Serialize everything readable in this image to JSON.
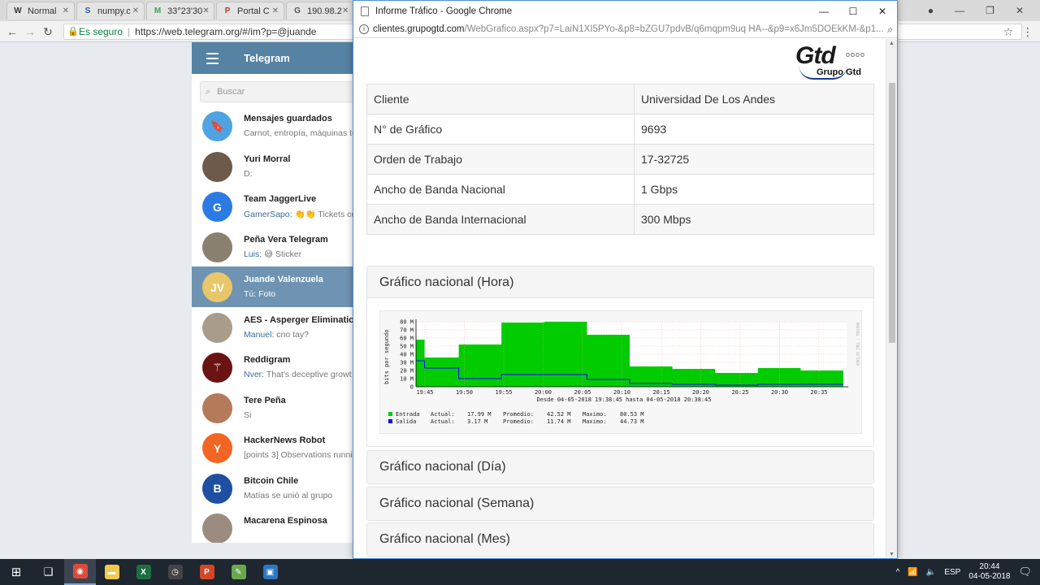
{
  "bg_browser": {
    "tabs": [
      {
        "label": "Normal",
        "icon": "wikipedia-icon",
        "glyph": "W",
        "color": "#333333"
      },
      {
        "label": "numpy.c",
        "icon": "numpy-icon",
        "glyph": "S",
        "color": "#2a5db0"
      },
      {
        "label": "33°23'30",
        "icon": "maps-icon",
        "glyph": "M",
        "color": "#34a853"
      },
      {
        "label": "Portal C",
        "icon": "portal-icon",
        "glyph": "P",
        "color": "#c0392b"
      },
      {
        "label": "190.98.2",
        "icon": "chart-tab-icon",
        "glyph": "G",
        "color": "#555555"
      }
    ],
    "secure_label": "Es seguro",
    "url": "https://web.telegram.org/#/im?p=@juande"
  },
  "telegram": {
    "title": "Telegram",
    "search_placeholder": "Buscar",
    "chats": [
      {
        "name": "Mensajes guardados",
        "who": "",
        "msg": "Carnot, entropía, máquinas té",
        "avatar_color": "#4fa3e0",
        "avatar_text": "🔖",
        "active": false
      },
      {
        "name": "Yuri Morral",
        "who": "",
        "msg": "D:",
        "avatar_color": "#6d5a4b",
        "avatar_text": "",
        "active": false
      },
      {
        "name": "Team JaggerLive",
        "who": "GamerSapo:",
        "msg": "👏👏 Tickets co",
        "avatar_color": "#2c7be5",
        "avatar_text": "G",
        "active": false
      },
      {
        "name": "Peña Vera Telegram",
        "who": "Luis:",
        "msg": "😅 Sticker",
        "avatar_color": "#8a8070",
        "avatar_text": "",
        "active": false
      },
      {
        "name": "Juande Valenzuela",
        "who": "",
        "msg": "Tú: Foto",
        "avatar_color": "#e8c76a",
        "avatar_text": "JV",
        "active": true
      },
      {
        "name": "AES - Asperger Eliminatio",
        "who": "Manuel:",
        "msg": "cno tay?",
        "avatar_color": "#a99c8a",
        "avatar_text": "",
        "active": false
      },
      {
        "name": "Reddigram",
        "who": "Nver:",
        "msg": "That's deceptive growt",
        "avatar_color": "#6b1212",
        "avatar_text": "⚚",
        "active": false
      },
      {
        "name": "Tere Peña",
        "who": "",
        "msg": "Si",
        "avatar_color": "#b57a5a",
        "avatar_text": "",
        "active": false
      },
      {
        "name": "HackerNews Robot",
        "who": "",
        "msg": "[points 3] Observations runni",
        "avatar_color": "#f26522",
        "avatar_text": "Y",
        "active": false
      },
      {
        "name": "Bitcoin Chile",
        "who": "",
        "msg": "Matías se unió al grupo",
        "avatar_color": "#1e4fa0",
        "avatar_text": "B",
        "active": false
      },
      {
        "name": "Macarena Espinosa",
        "who": "",
        "msg": "",
        "avatar_color": "#9c8c80",
        "avatar_text": "",
        "active": false
      }
    ]
  },
  "popup": {
    "window_title": "Informe Tráfico - Google Chrome",
    "url_host": "clientes.grupogtd.com",
    "url_path": "/WebGrafico.aspx?p7=LaiN1XI5PYo-&p8=bZGU7pdvB/q6mqpm9uq HA--&p9=x6Jm5DOEkKM-&p1...",
    "logo_text": "Gtd",
    "logo_dots": "oooo",
    "logo_sub": "Grupo Gtd",
    "info_rows": [
      {
        "k": "Cliente",
        "v": "Universidad De Los Andes"
      },
      {
        "k": "N° de Gráfico",
        "v": "9693"
      },
      {
        "k": "Orden de Trabajo",
        "v": "17-32725"
      },
      {
        "k": "Ancho de Banda Nacional",
        "v": "1 Gbps"
      },
      {
        "k": "Ancho de Banda Internacional",
        "v": "300 Mbps"
      }
    ],
    "panels": [
      {
        "title": "Gráfico nacional (Hora)"
      },
      {
        "title": "Gráfico nacional (Día)"
      },
      {
        "title": "Gráfico nacional (Semana)"
      },
      {
        "title": "Gráfico nacional (Mes)"
      }
    ]
  },
  "chart_data": {
    "type": "area",
    "ylabel": "bits por segundo",
    "right_label": "RRDTOOL / TOBI OETIKER",
    "ylim": [
      0,
      80
    ],
    "y_ticks": [
      "0",
      "10 M",
      "20 M",
      "30 M",
      "40 M",
      "50 M",
      "60 M",
      "70 M",
      "80 M"
    ],
    "x_tick_labels": [
      "19:45",
      "19:50",
      "19:55",
      "20:00",
      "20:05",
      "20:10",
      "20:15",
      "20:20",
      "20:25",
      "20:30",
      "20:35"
    ],
    "time_range": "Desde 04-05-2018 19:38:45 hasta 04-05-2018 20:38:45",
    "series": [
      {
        "name": "Entrada",
        "color": "#00cc00",
        "values": [
          58,
          36,
          36,
          36,
          36,
          52,
          52,
          52,
          52,
          52,
          79,
          79,
          79,
          79,
          79,
          80,
          80,
          80,
          80,
          80,
          64,
          64,
          64,
          64,
          64,
          25,
          25,
          25,
          25,
          25,
          22,
          22,
          22,
          22,
          22,
          17,
          17,
          17,
          17,
          17,
          23,
          23,
          23,
          23,
          23,
          20,
          20,
          20,
          20,
          20,
          18
        ],
        "legend": {
          "actual": "17.99 M",
          "promedio": "42.52 M",
          "maximo": "80.53 M"
        }
      },
      {
        "name": "Salida",
        "color": "#0000ff",
        "values": [
          32,
          23,
          23,
          23,
          23,
          10,
          10,
          10,
          10,
          10,
          15,
          15,
          15,
          15,
          15,
          15,
          15,
          15,
          15,
          15,
          9,
          9,
          9,
          9,
          9,
          4,
          4,
          4,
          4,
          4,
          3,
          3,
          3,
          3,
          3,
          2,
          2,
          2,
          2,
          2,
          3,
          3,
          3,
          3,
          3,
          3,
          3,
          3,
          3,
          3,
          3
        ],
        "legend": {
          "actual": "3.17 M",
          "promedio": "11.74 M",
          "maximo": "44.73 M"
        }
      }
    ],
    "legend_labels": {
      "actual": "Actual:",
      "promedio": "Promedio:",
      "maximo": "Maximo:"
    }
  },
  "taskbar": {
    "apps": [
      {
        "name": "chrome",
        "glyph": "◉",
        "color": "#dd4b39",
        "active": true
      },
      {
        "name": "explorer",
        "glyph": "▬",
        "color": "#f2c94c",
        "active": false
      },
      {
        "name": "excel",
        "glyph": "X",
        "color": "#1d6f42",
        "active": false
      },
      {
        "name": "clock-app",
        "glyph": "◷",
        "color": "#444444",
        "active": false
      },
      {
        "name": "powerpoint",
        "glyph": "P",
        "color": "#d24726",
        "active": false
      },
      {
        "name": "tool",
        "glyph": "✎",
        "color": "#6aa84f",
        "active": false
      },
      {
        "name": "remote",
        "glyph": "▣",
        "color": "#2b78c2",
        "active": false
      }
    ],
    "lang": "ESP",
    "time": "20:44",
    "date": "04-05-2018"
  }
}
